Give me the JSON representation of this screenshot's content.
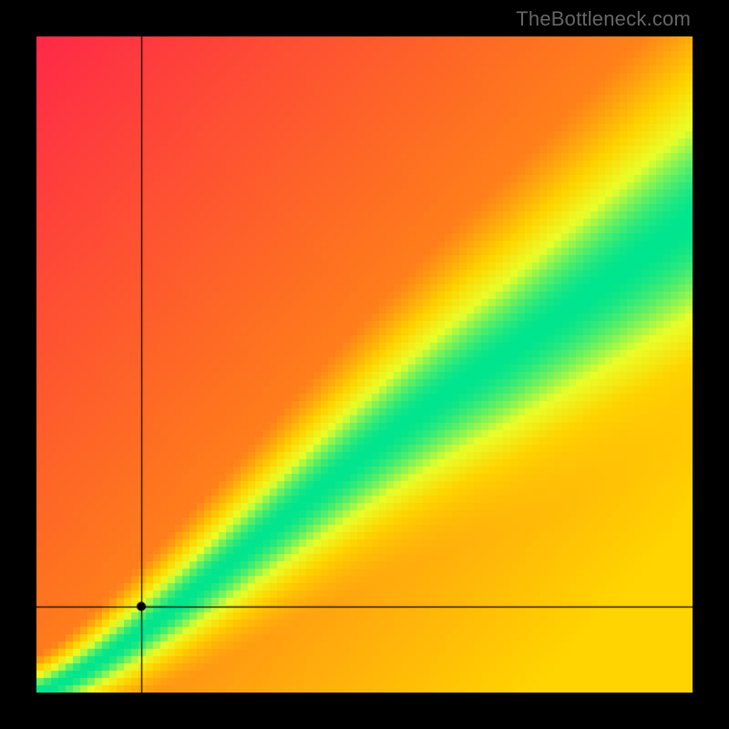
{
  "watermark": "TheBottleneck.com",
  "chart_data": {
    "type": "heatmap",
    "title": "",
    "xlabel": "",
    "ylabel": "",
    "xlim": [
      0,
      1
    ],
    "ylim": [
      0,
      1
    ],
    "marker_point": {
      "x": 0.16,
      "y": 0.13
    },
    "crosshair": {
      "x": 0.16,
      "y": 0.13
    },
    "ridge_curve_description": "optimal diagonal band from bottom-left to upper-right; slope > 1 so band exits near right edge at y≈0.72; band widens toward upper right",
    "color_stops": {
      "worst": "#fe2a48",
      "mid": "#ffd400",
      "good": "#eaff2a",
      "best": "#00e58f"
    },
    "notes": "Value field shown as smooth heatmap; green = balanced (no bottleneck), red = severe bottleneck, yellow/orange intermediate. Black crosshair lines and black dot mark selected configuration near lower-left inside green band."
  }
}
